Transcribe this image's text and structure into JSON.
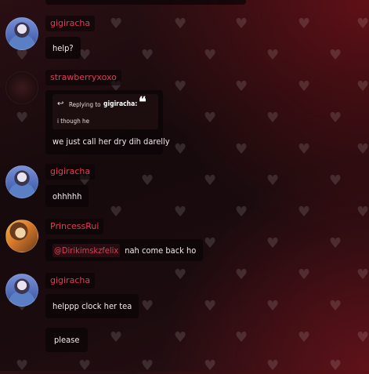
{
  "messages": [
    {
      "id": "m1",
      "user": "gigiracha",
      "avatar": "gigiracha-avatar",
      "texts": [
        "help?"
      ]
    },
    {
      "id": "m2",
      "user": "strawberryxoxo",
      "avatar": "strawberryxoxo-avatar",
      "reply": {
        "prefix": "Replying to",
        "user": "gigiracha:",
        "text": "i though he"
      },
      "texts": [
        "we just call her dry dih darelly"
      ]
    },
    {
      "id": "m3",
      "user": "gigiracha",
      "avatar": "gigiracha-avatar",
      "texts": [
        "ohhhhh"
      ]
    },
    {
      "id": "m4",
      "user": "PrincessRui",
      "avatar": "princessrui-avatar",
      "mention": "@Dirikimskzfelix",
      "texts": [
        "nah come back ho"
      ]
    },
    {
      "id": "m5",
      "user": "gigiracha",
      "avatar": "gigiracha-avatar",
      "texts": [
        "helppp clock her tea",
        "please"
      ]
    }
  ],
  "icons": {
    "reply": "reply-arrow-icon",
    "quote": "quote-icon",
    "background": "heart-pattern"
  },
  "colors": {
    "username": "#e33b55",
    "bubble_bg": "#0a0406",
    "text": "#f2e9ea"
  }
}
